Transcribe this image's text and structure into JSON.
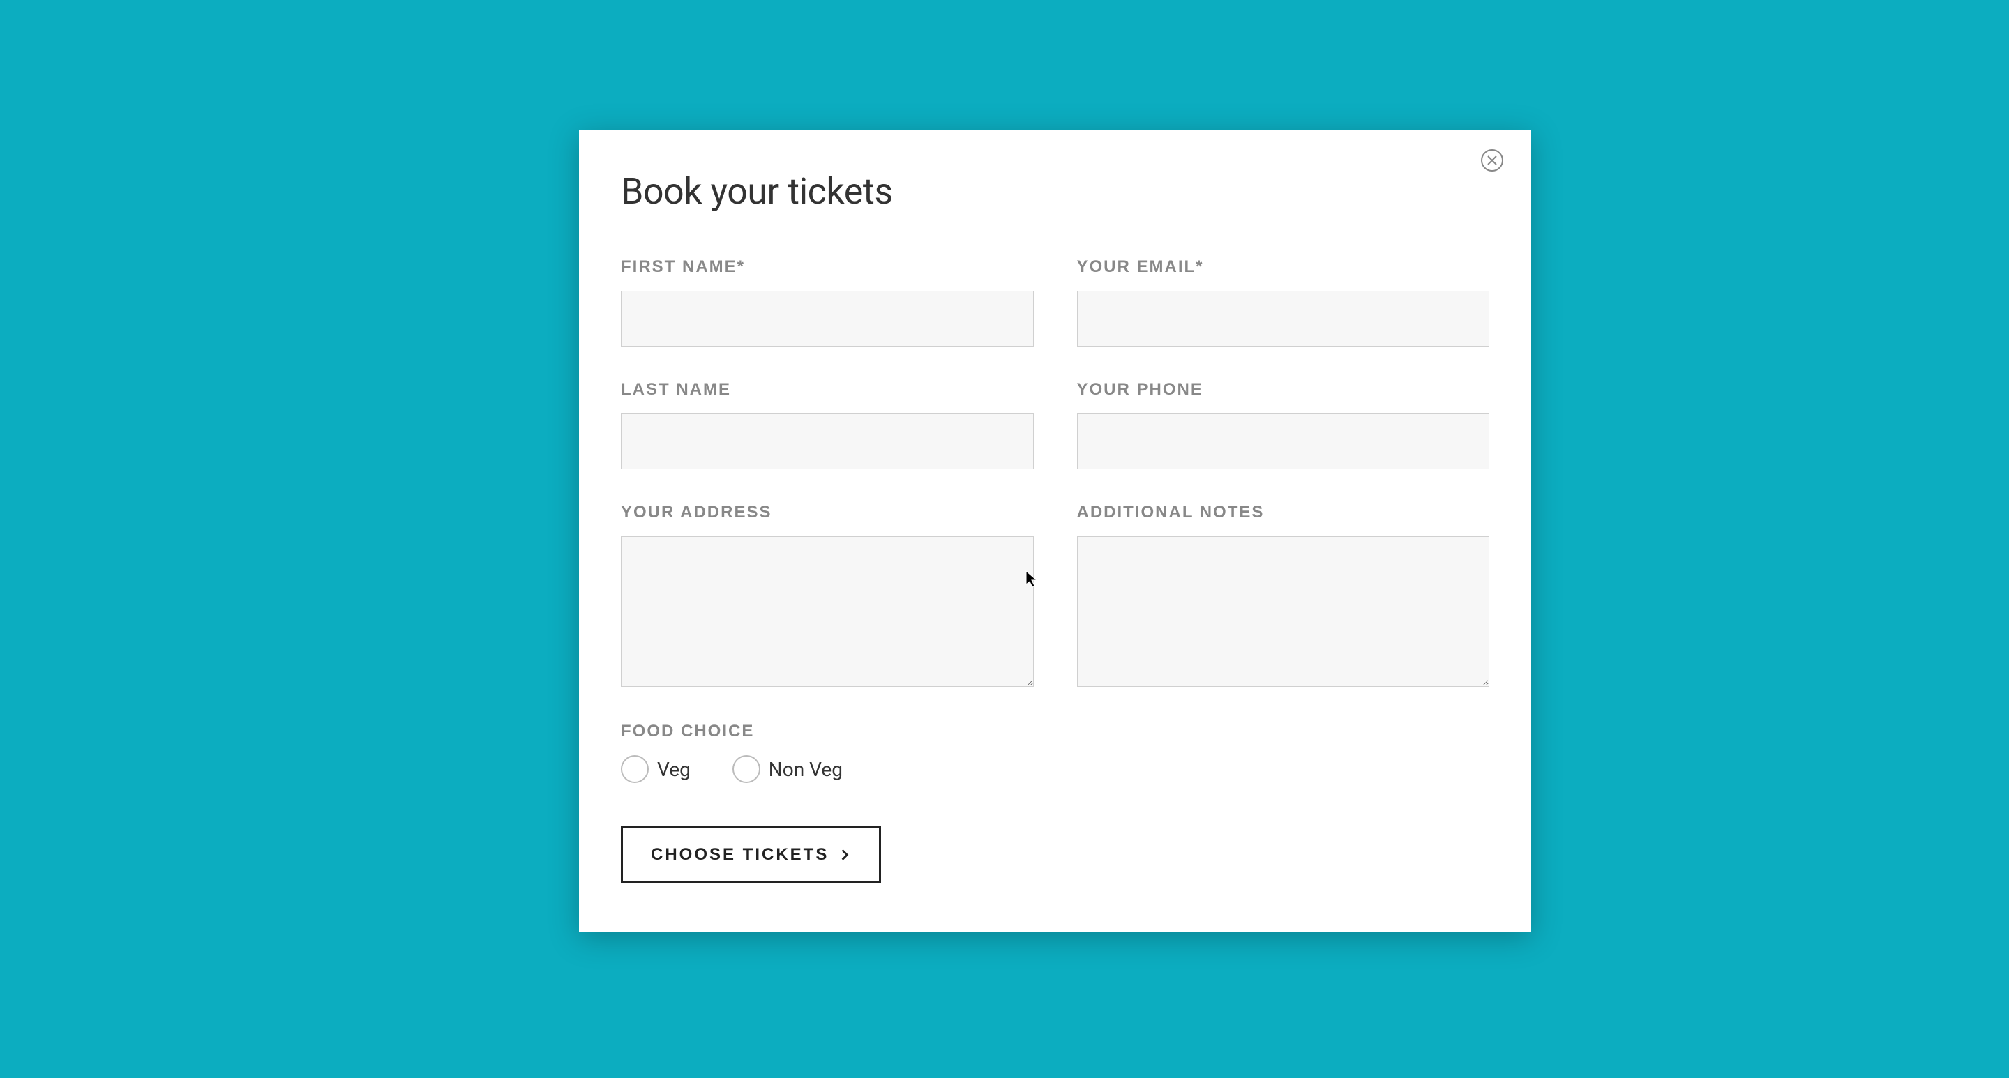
{
  "modal": {
    "title": "Book your tickets",
    "fields": {
      "first_name": {
        "label": "FIRST NAME*",
        "value": ""
      },
      "email": {
        "label": "YOUR EMAIL*",
        "value": ""
      },
      "last_name": {
        "label": "LAST NAME",
        "value": ""
      },
      "phone": {
        "label": "YOUR PHONE",
        "value": ""
      },
      "address": {
        "label": "YOUR ADDRESS",
        "value": ""
      },
      "notes": {
        "label": "ADDITIONAL NOTES",
        "value": ""
      }
    },
    "food": {
      "label": "FOOD CHOICE",
      "options": [
        "Veg",
        "Non Veg"
      ]
    },
    "submit_label": "CHOOSE TICKETS"
  }
}
